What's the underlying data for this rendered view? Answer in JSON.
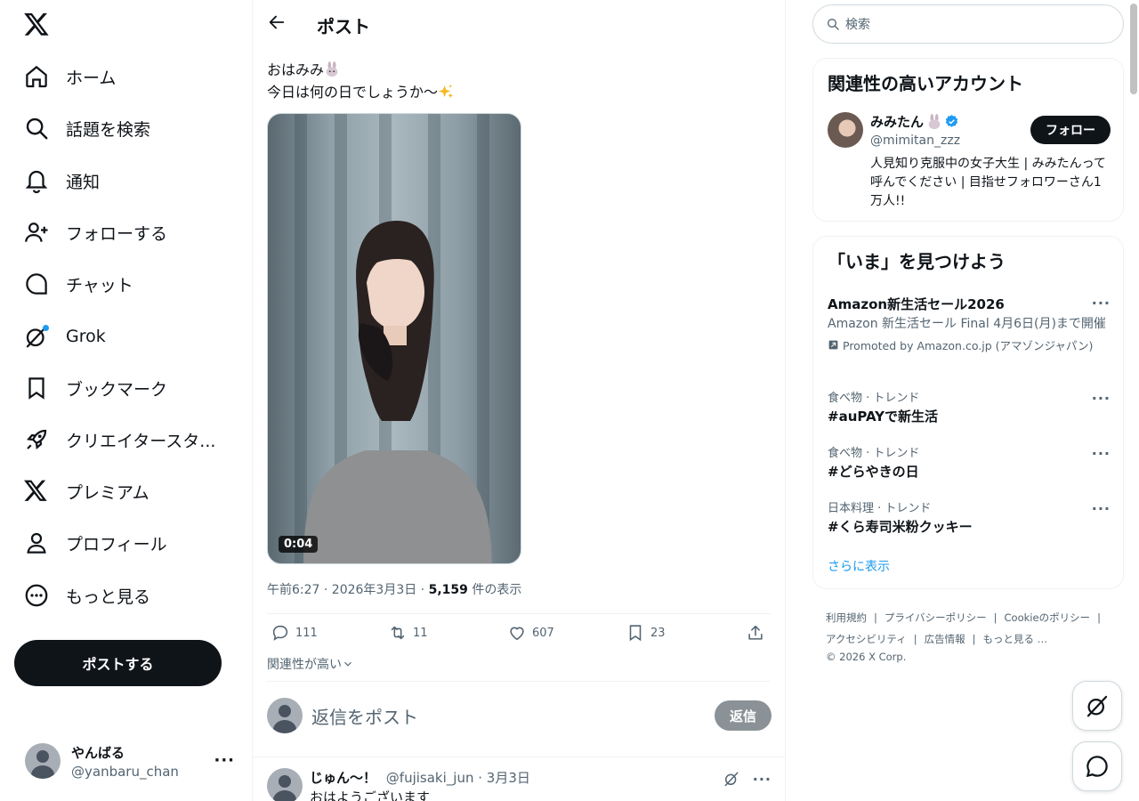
{
  "sidebar": {
    "items": [
      {
        "label": "ホーム",
        "icon": "home-icon"
      },
      {
        "label": "話題を検索",
        "icon": "search-icon"
      },
      {
        "label": "通知",
        "icon": "bell-icon"
      },
      {
        "label": "フォローする",
        "icon": "person-plus-icon"
      },
      {
        "label": "チャット",
        "icon": "chat-icon"
      },
      {
        "label": "Grok",
        "icon": "grok-icon"
      },
      {
        "label": "ブックマーク",
        "icon": "bookmark-icon"
      },
      {
        "label": "クリエイタースタ...",
        "icon": "rocket-icon"
      },
      {
        "label": "プレミアム",
        "icon": "x-logo-icon"
      },
      {
        "label": "プロフィール",
        "icon": "profile-icon"
      },
      {
        "label": "もっと見る",
        "icon": "more-circle-icon"
      }
    ],
    "post_button": "ポストする",
    "account": {
      "name": "やんばる",
      "handle": "@yanbaru_chan"
    }
  },
  "header": {
    "title": "ポスト"
  },
  "post": {
    "line1": "おはみみ",
    "line2": "今日は何の日でしょうか〜",
    "video_duration": "0:04",
    "time": "午前6:27 · 2026年3月3日 · ",
    "views": "5,159",
    "views_suffix": " 件の表示",
    "replies": "111",
    "reposts": "11",
    "likes": "607",
    "bookmarks": "23"
  },
  "relevance": "関連性が高い",
  "reply_box": {
    "placeholder": "返信をポスト",
    "button": "返信"
  },
  "reply": {
    "name": "じゅん〜！",
    "handle": "@fujisaki_jun",
    "date": "· 3月3日",
    "text": "おはようございます"
  },
  "right": {
    "search_placeholder": "検索",
    "suggest_title": "関連性の高いアカウント",
    "suggest": {
      "name": "みみたん",
      "handle": "@mimitan_zzz",
      "follow": "フォロー",
      "bio": "人見知り克服中の女子大生 | みみたんって呼んでください | 目指せフォロワーさん1万人!!"
    },
    "trends_title": "「いま」を見つけよう",
    "trends": [
      {
        "name": "Amazon新生活セール2026",
        "desc": "Amazon 新生活セール Final 4月6日(月)まで開催",
        "promo": "Promoted by Amazon.co.jp (アマゾンジャパン)"
      },
      {
        "category": "食べ物 · トレンド",
        "name": "#auPAYで新生活"
      },
      {
        "category": "食べ物 · トレンド",
        "name": "#どらやきの日"
      },
      {
        "category": "日本料理 · トレンド",
        "name": "#くら寿司米粉クッキー"
      }
    ],
    "show_more": "さらに表示",
    "footer": {
      "l1": "利用規約",
      "l2": "プライバシーポリシー",
      "l3": "Cookieのポリシー",
      "l4": "アクセシビリティ",
      "l5": "広告情報",
      "l6": "もっと見る …",
      "copyright": "© 2026 X Corp."
    }
  },
  "colors": {
    "accent": "#1d9bf0",
    "text": "#0f1419",
    "muted": "#536471",
    "border": "#eff3f4"
  }
}
